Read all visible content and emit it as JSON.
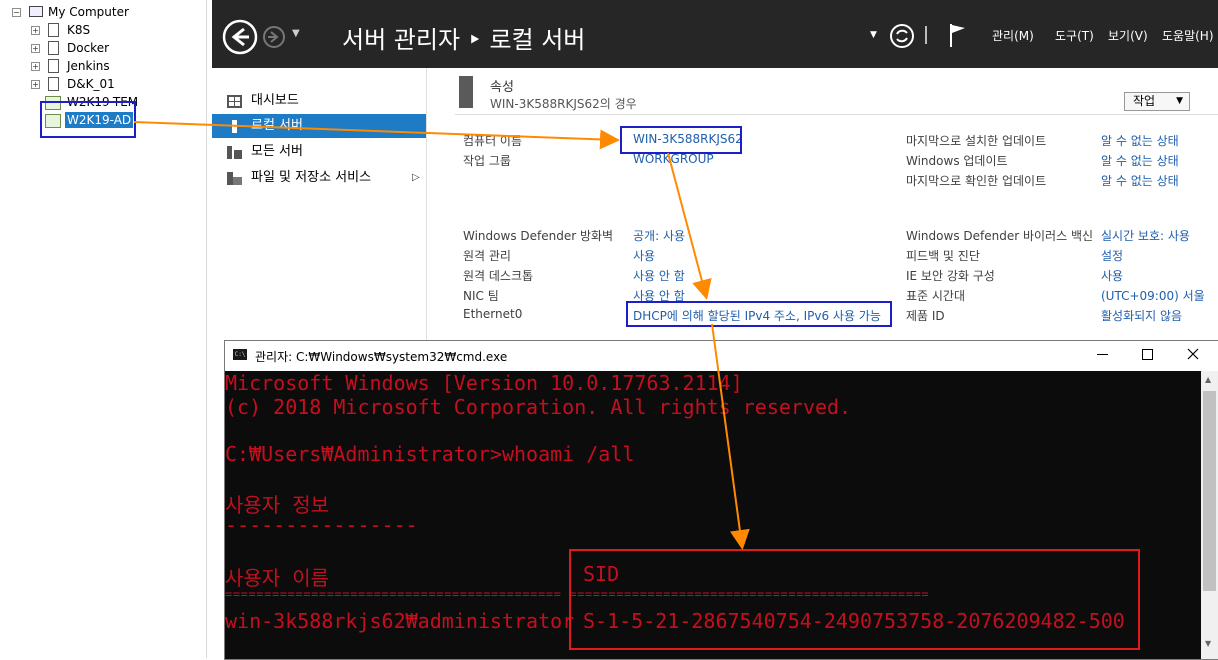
{
  "tree": {
    "root": "My Computer",
    "items": [
      "K8S",
      "Docker",
      "Jenkins",
      "D&K_01",
      "W2K19-TEM",
      "W2K19-AD"
    ]
  },
  "server_manager": {
    "title": "서버 관리자 ‣ 로컬 서버",
    "menu": [
      "관리(M)",
      "도구(T)",
      "보기(V)",
      "도움말(H)"
    ],
    "nav": [
      "대시보드",
      "로컬 서버",
      "모든 서버",
      "파일 및 저장소 서비스"
    ],
    "nav_expand_glyph": "▷",
    "props_header": "속성",
    "props_sub": "WIN-3K588RKJS62의 경우",
    "task_button": "작업",
    "left_labels": [
      "컴퓨터 이름",
      "작업 그룹",
      "Windows Defender 방화벽",
      "원격 관리",
      "원격 데스크톱",
      "NIC 팀",
      "Ethernet0"
    ],
    "left_values": [
      "WIN-3K588RKJS62",
      "WORKGROUP",
      "공개: 사용",
      "사용",
      "사용 안 함",
      "사용 안 함",
      "DHCP에 의해 할당된 IPv4 주소, IPv6 사용 가능"
    ],
    "right_labels": [
      "마지막으로 설치한 업데이트",
      "Windows 업데이트",
      "마지막으로 확인한 업데이트",
      "Windows Defender 바이러스 백신",
      "피드백 및 진단",
      "IE 보안 강화 구성",
      "표준 시간대",
      "제품 ID"
    ],
    "right_values": [
      "알 수 없는 상태",
      "알 수 없는 상태",
      "알 수 없는 상태",
      "실시간 보호: 사용",
      "설정",
      "사용",
      "(UTC+09:00) 서울",
      "활성화되지 않음"
    ]
  },
  "cmd": {
    "title": "관리자: C:₩Windows₩system32₩cmd.exe",
    "icon_text": "C:\\",
    "lines": [
      "Microsoft Windows [Version 10.0.17763.2114]",
      "(c) 2018 Microsoft Corporation. All rights reserved.",
      "C:₩Users₩Administrator>whoami /all",
      "사용자 정보",
      "----------------",
      "사용자 이름",
      "SID",
      "=========================================== ==============================================",
      "win-3k588rkjs62₩administrator",
      "S-1-5-21-2867540754-2490753758-2076209482-500"
    ]
  },
  "colors": {
    "header_bg": "#262626",
    "selected_nav": "#1e7bc6",
    "link": "#1f5fae",
    "cmd_text": "#c50f1f",
    "annot_blue": "#1e1ec8",
    "annot_red": "#e11b1b",
    "arrow": "#ff8a00"
  }
}
